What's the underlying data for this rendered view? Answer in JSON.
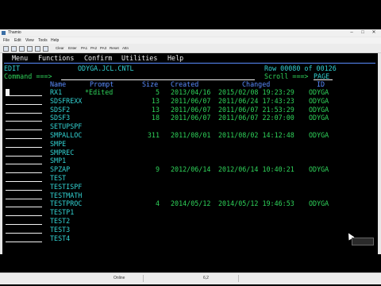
{
  "window": {
    "title": "Thamio"
  },
  "app_menu": [
    "File",
    "Edit",
    "View",
    "Tools",
    "Help"
  ],
  "toolbar": [
    "Clear",
    "Enter",
    "PA1",
    "PA2",
    "PA3",
    "Reset",
    "Attn"
  ],
  "pdm_menu": [
    "Menu",
    "Functions",
    "Confirm",
    "Utilities",
    "Help"
  ],
  "header": {
    "mode": "EDIT",
    "dataset": "ODYGA.JCL.CNTL",
    "row_info": "Row 00080 of 00126",
    "command_label": "Command ===>",
    "scroll_label": "Scroll ===>",
    "scroll_value": "PAGE"
  },
  "columns": {
    "name": "Name",
    "prompt": "Prompt",
    "size": "Size",
    "created": "Created",
    "changed": "Changed",
    "id": "ID"
  },
  "rows": [
    {
      "name": "RX1",
      "prompt": "*Edited",
      "size": "5",
      "created": "2013/04/16",
      "changed": "2015/02/08 19:23:29",
      "id": "ODYGA"
    },
    {
      "name": "SDSFREXX",
      "prompt": "",
      "size": "13",
      "created": "2011/06/07",
      "changed": "2011/06/24 17:43:23",
      "id": "ODYGA"
    },
    {
      "name": "SDSF2",
      "prompt": "",
      "size": "13",
      "created": "2011/06/07",
      "changed": "2011/06/07 21:53:29",
      "id": "ODYGA"
    },
    {
      "name": "SDSF3",
      "prompt": "",
      "size": "18",
      "created": "2011/06/07",
      "changed": "2011/06/07 22:07:00",
      "id": "ODYGA"
    },
    {
      "name": "SETUPSPF",
      "prompt": "",
      "size": "",
      "created": "",
      "changed": "",
      "id": ""
    },
    {
      "name": "SMPALLOC",
      "prompt": "",
      "size": "311",
      "created": "2011/08/01",
      "changed": "2011/08/02 14:12:48",
      "id": "ODYGA"
    },
    {
      "name": "SMPE",
      "prompt": "",
      "size": "",
      "created": "",
      "changed": "",
      "id": ""
    },
    {
      "name": "SMPREC",
      "prompt": "",
      "size": "",
      "created": "",
      "changed": "",
      "id": ""
    },
    {
      "name": "SMP1",
      "prompt": "",
      "size": "",
      "created": "",
      "changed": "",
      "id": ""
    },
    {
      "name": "SPZAP",
      "prompt": "",
      "size": "9",
      "created": "2012/06/14",
      "changed": "2012/06/14 10:40:21",
      "id": "ODYGA"
    },
    {
      "name": "TEST",
      "prompt": "",
      "size": "",
      "created": "",
      "changed": "",
      "id": ""
    },
    {
      "name": "TESTISPF",
      "prompt": "",
      "size": "",
      "created": "",
      "changed": "",
      "id": ""
    },
    {
      "name": "TESTMATH",
      "prompt": "",
      "size": "",
      "created": "",
      "changed": "",
      "id": ""
    },
    {
      "name": "TESTPROC",
      "prompt": "",
      "size": "4",
      "created": "2014/05/12",
      "changed": "2014/05/12 19:46:53",
      "id": "ODYGA"
    },
    {
      "name": "TESTP1",
      "prompt": "",
      "size": "",
      "created": "",
      "changed": "",
      "id": ""
    },
    {
      "name": "TEST2",
      "prompt": "",
      "size": "",
      "created": "",
      "changed": "",
      "id": ""
    },
    {
      "name": "TEST3",
      "prompt": "",
      "size": "",
      "created": "",
      "changed": "",
      "id": ""
    },
    {
      "name": "TEST4",
      "prompt": "",
      "size": "",
      "created": "",
      "changed": "",
      "id": ""
    }
  ],
  "status": {
    "connection": "Online",
    "position": "6,2"
  },
  "colors": {
    "screen_bg": "#000000",
    "cyan": "#32d2d2",
    "green": "#2fd35a",
    "white": "#f2f2f2",
    "yellow": "#e6e63c"
  }
}
